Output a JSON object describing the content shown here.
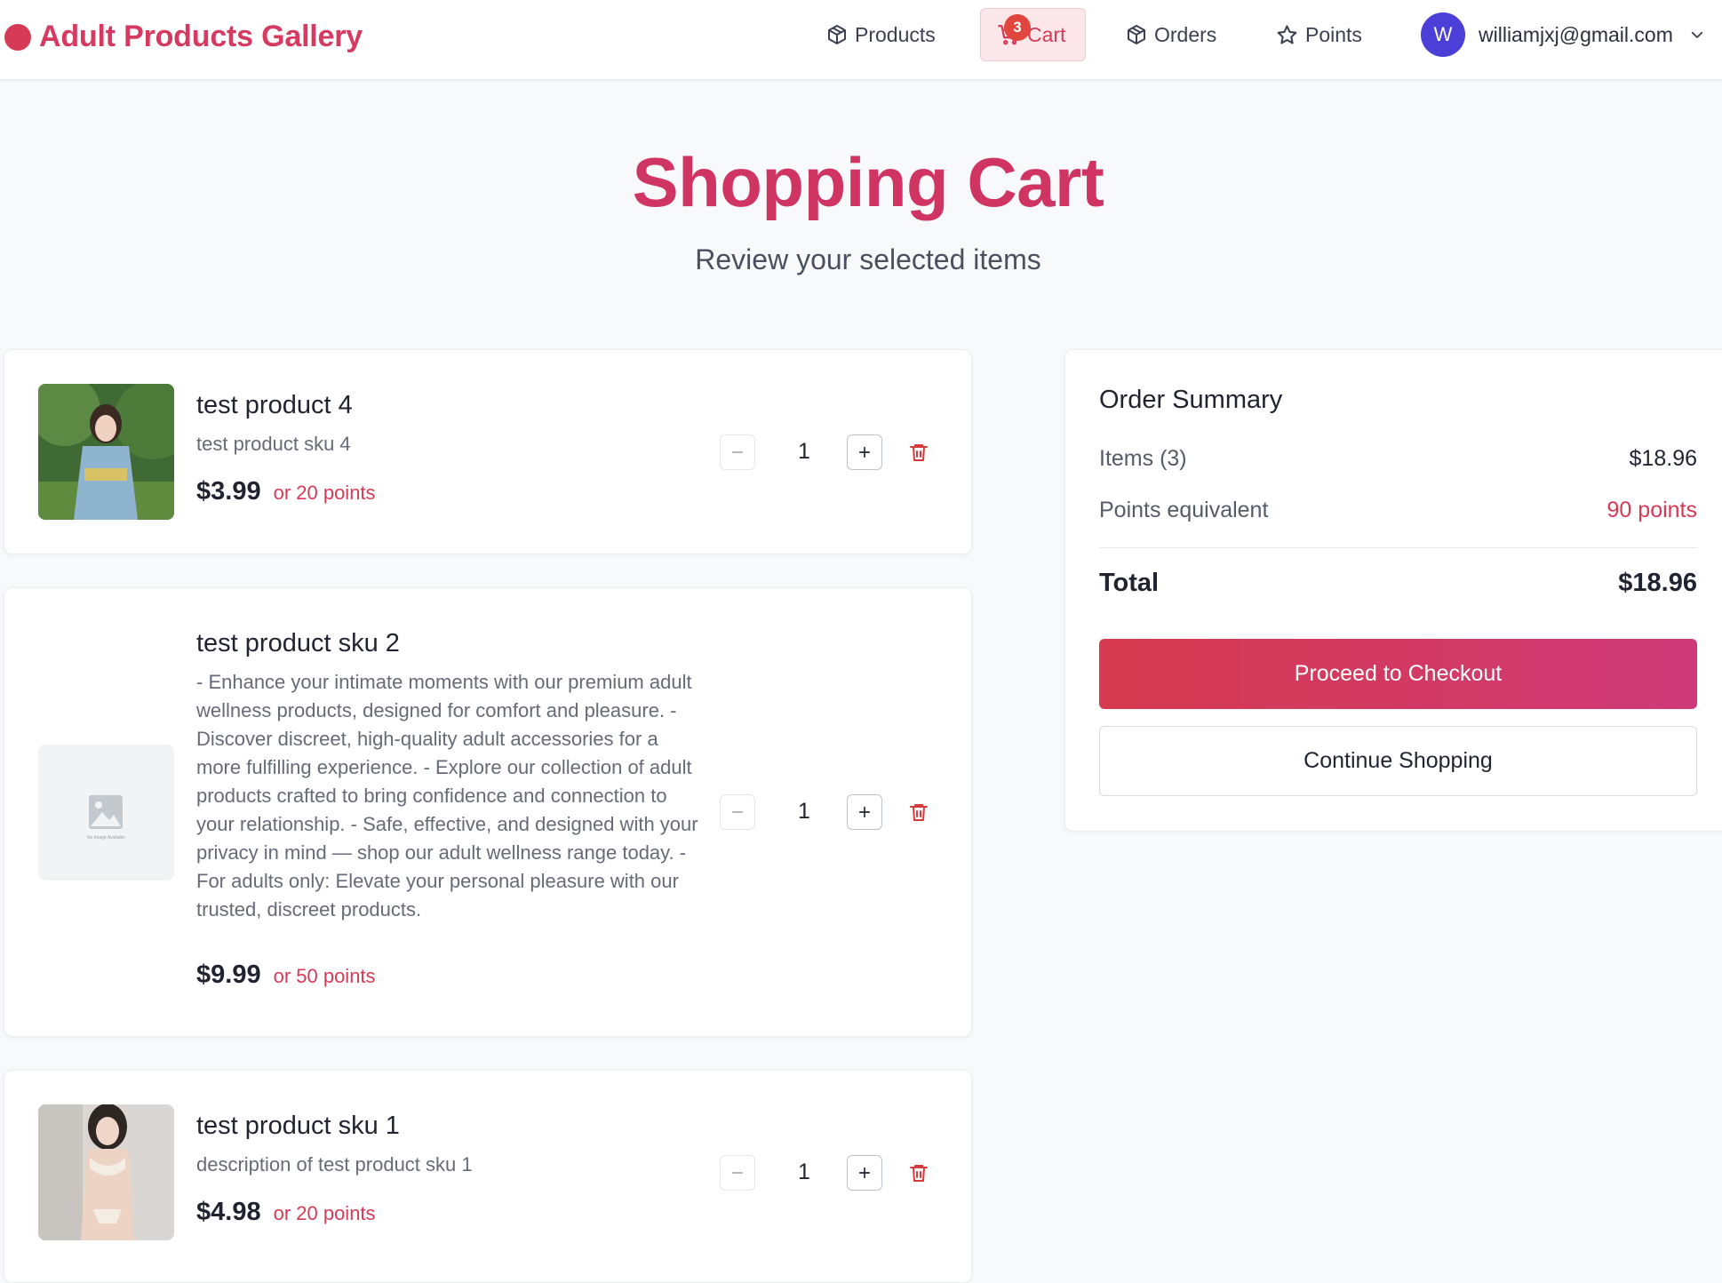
{
  "brand": {
    "name": "Adult Products Gallery",
    "color": "#d63a60"
  },
  "nav": {
    "products": "Products",
    "cart": "Cart",
    "cart_count": "3",
    "orders": "Orders",
    "points": "Points"
  },
  "user": {
    "initial": "W",
    "email": "williamjxj@gmail.com"
  },
  "page": {
    "title": "Shopping Cart",
    "subtitle": "Review your selected items"
  },
  "cart_items": [
    {
      "name": "test product 4",
      "description": "test product sku 4",
      "price": "$3.99",
      "points": "or 20 points",
      "quantity": "1",
      "image": "photo"
    },
    {
      "name": "test product sku 2",
      "description": "- Enhance your intimate moments with our premium adult wellness products, designed for comfort and pleasure. - Discover discreet, high-quality adult accessories for a more fulfilling experience. - Explore our collection of adult products crafted to bring confidence and connection to your relationship. - Safe, effective, and designed with your privacy in mind — shop our adult wellness range today. - For adults only: Elevate your personal pleasure with our trusted, discreet products.",
      "price": "$9.99",
      "points": "or 50 points",
      "quantity": "1",
      "image": "placeholder",
      "placeholder_text": "No Image Available"
    },
    {
      "name": "test product sku 1",
      "description": "description of test product sku 1",
      "price": "$4.98",
      "points": "or 20 points",
      "quantity": "1",
      "image": "photo"
    }
  ],
  "summary": {
    "title": "Order Summary",
    "items_label": "Items (3)",
    "items_value": "$18.96",
    "points_label": "Points equivalent",
    "points_value": "90 points",
    "total_label": "Total",
    "total_value": "$18.96",
    "checkout_label": "Proceed to Checkout",
    "continue_label": "Continue Shopping"
  },
  "icons": {
    "brand": "circle-logo-icon",
    "products": "package-icon",
    "cart": "shopping-cart-icon",
    "orders": "package-icon",
    "points": "star-icon",
    "user_menu": "chevron-down-icon",
    "decrease": "minus-icon",
    "increase": "plus-icon",
    "remove": "trash-icon"
  },
  "colors": {
    "accent": "#d63a56",
    "avatar": "#4b3fd8",
    "badge": "#e0463e"
  }
}
